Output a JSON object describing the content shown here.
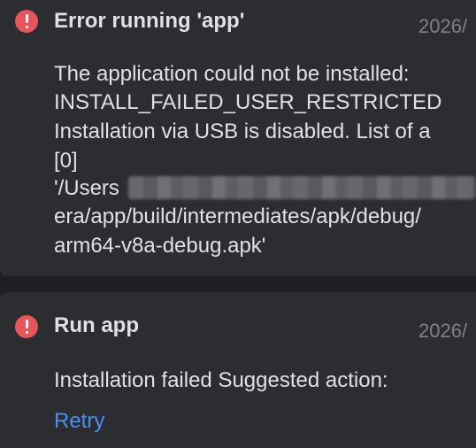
{
  "notifications": [
    {
      "title": "Error running 'app'",
      "time": "2026/",
      "icon": "error-icon",
      "message_lines": [
        "The application could not be installed:",
        "INSTALL_FAILED_USER_RESTRICTED",
        "Installation via USB is disabled. List of a",
        "[0]",
        "'/Users",
        "era/app/build/intermediates/apk/debug/",
        "arm64-v8a-debug.apk'"
      ]
    },
    {
      "title": "Run app",
      "time": "2026/",
      "icon": "error-icon",
      "message": "Installation failed Suggested action:",
      "action_label": "Retry"
    }
  ],
  "colors": {
    "background": "#1e1f22",
    "panel": "#2b2d30",
    "error": "#e5555b",
    "text": "#dfe1e5",
    "muted": "#7e8187",
    "link": "#4d8ff0"
  }
}
